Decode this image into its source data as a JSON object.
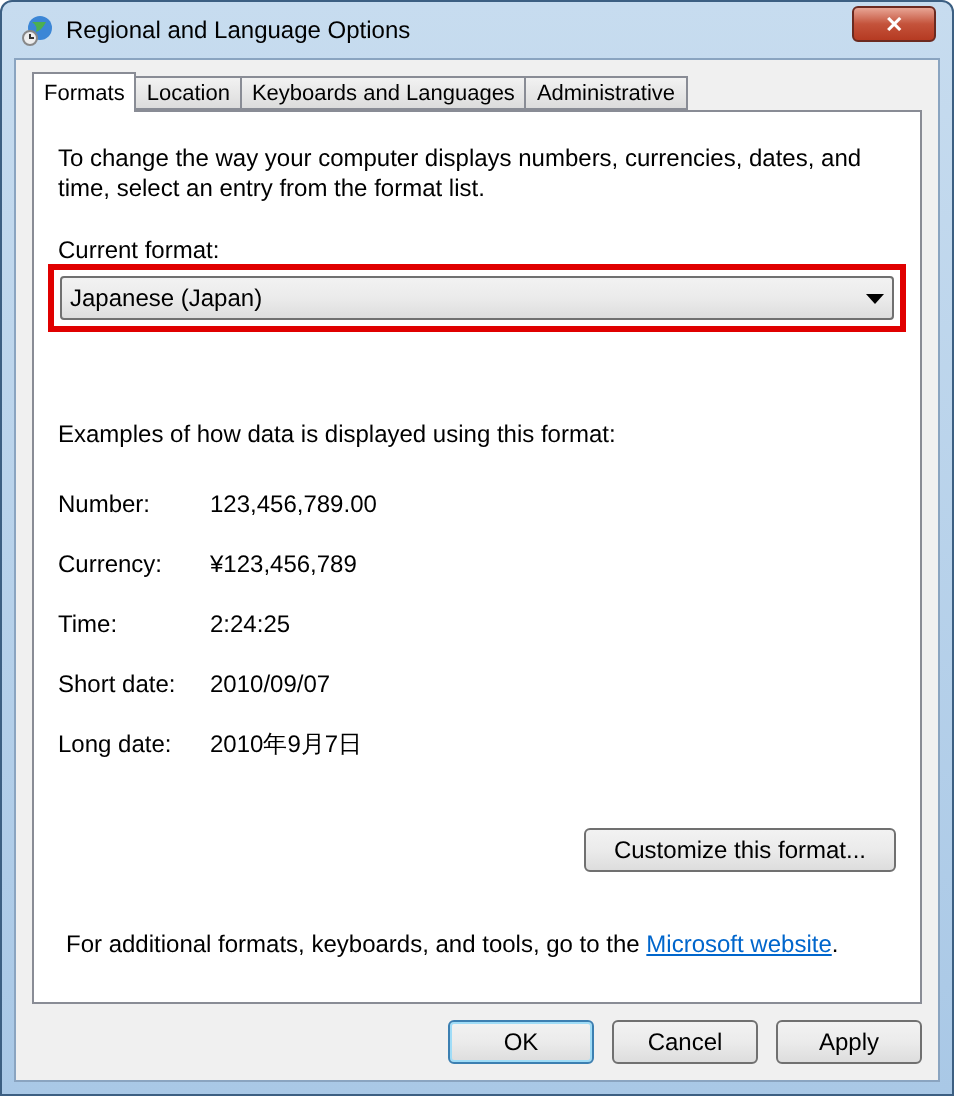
{
  "window": {
    "title": "Regional and Language Options",
    "close": "✕"
  },
  "tabs": [
    {
      "label": "Formats",
      "selected": true
    },
    {
      "label": "Location",
      "selected": false
    },
    {
      "label": "Keyboards and Languages",
      "selected": false
    },
    {
      "label": "Administrative",
      "selected": false
    }
  ],
  "intro": "To change the way your computer displays numbers, currencies, dates, and time, select an entry from the format list.",
  "current_format": {
    "label": "Current format:",
    "value": "Japanese (Japan)",
    "highlighted": true
  },
  "examples_heading": "Examples of how data is displayed using this format:",
  "examples": [
    {
      "label": "Number:",
      "value": "123,456,789.00"
    },
    {
      "label": "Currency:",
      "value": "¥123,456,789"
    },
    {
      "label": "Time:",
      "value": "2:24:25"
    },
    {
      "label": "Short date:",
      "value": "2010/09/07"
    },
    {
      "label": "Long date:",
      "value": "2010年9月7日"
    }
  ],
  "customize_button": "Customize this format...",
  "footer": {
    "text": "For additional formats, keyboards, and tools, go to the ",
    "link": "Microsoft website",
    "suffix": "."
  },
  "buttons": [
    {
      "label": "OK",
      "default": true
    },
    {
      "label": "Cancel",
      "default": false
    },
    {
      "label": "Apply",
      "default": false
    }
  ]
}
